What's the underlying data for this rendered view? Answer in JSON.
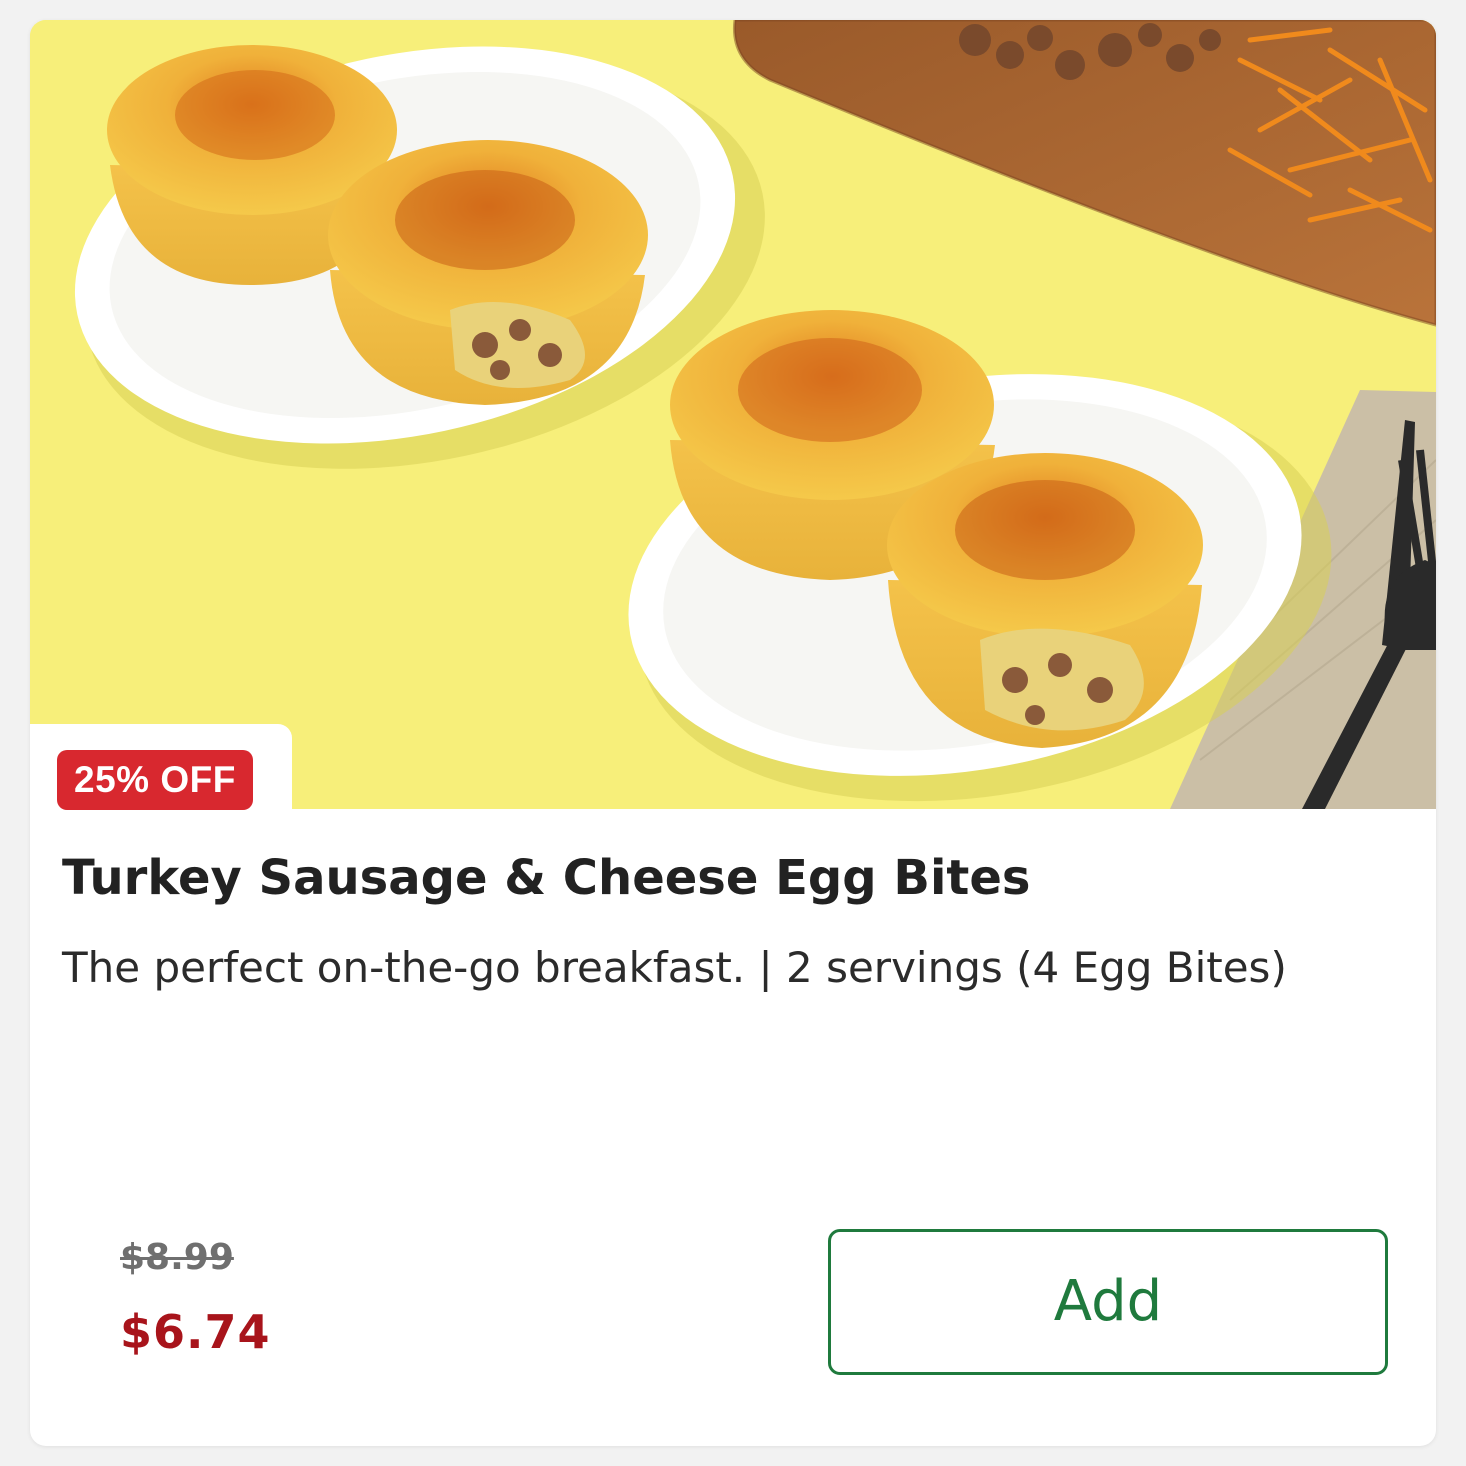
{
  "product": {
    "badge": "25% OFF",
    "title": "Turkey Sausage & Cheese Egg Bites",
    "description": "The perfect on-the-go breakfast. | 2 servings (4 Egg Bites)",
    "original_price": "$8.99",
    "sale_price": "$6.74",
    "add_label": "Add",
    "image_icon": "egg-bites-photo"
  },
  "colors": {
    "badge_bg": "#d8282f",
    "sale_price": "#a8141b",
    "add_accent": "#1f7a3d",
    "hero_bg": "#f7ef7a"
  }
}
